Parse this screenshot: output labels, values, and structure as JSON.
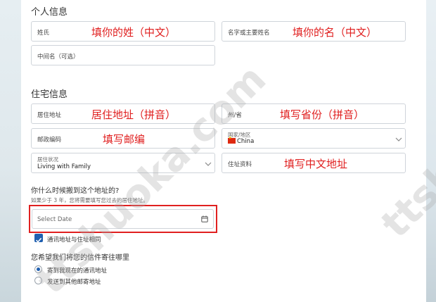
{
  "sections": {
    "personal": "个人信息",
    "residence": "住宅信息"
  },
  "fields": {
    "surname": {
      "label": "姓氏",
      "note": "填你的姓（中文）"
    },
    "given_name": {
      "label": "名字或主要姓名",
      "note": "填你的名（中文）"
    },
    "middle_name": {
      "label": "中间名（可选）"
    },
    "address": {
      "label": "居住地址",
      "note": "居住地址（拼音）"
    },
    "state": {
      "label": "州/省",
      "note": "填写省份（拼音）"
    },
    "postal": {
      "label": "邮政编码",
      "note": "填写邮编"
    },
    "country": {
      "label": "国家/地区",
      "value": "China"
    },
    "living_status": {
      "label": "居住状况",
      "value": "Living with Family"
    },
    "address_detail": {
      "label": "住址资料",
      "note": "填写中文地址"
    }
  },
  "move_in": {
    "question": "你什么时候搬到这个地址的?",
    "hint": "如果少于 3 年，您将需要填写您过去的居住地址。",
    "placeholder": "Select Date"
  },
  "mailing_same": {
    "label": "通讯地址与住址相同",
    "checked": true
  },
  "mail_pref": {
    "question": "您希望我们将您的信件寄往哪里",
    "options": [
      "寄到我现在的通讯地址",
      "发送到其他邮寄地址"
    ],
    "selected": 0
  },
  "watermark": {
    "main": "ttshuoka.com",
    "side": "ttsh"
  },
  "colors": {
    "note": "#e02020",
    "accent": "#1f5fb0"
  }
}
